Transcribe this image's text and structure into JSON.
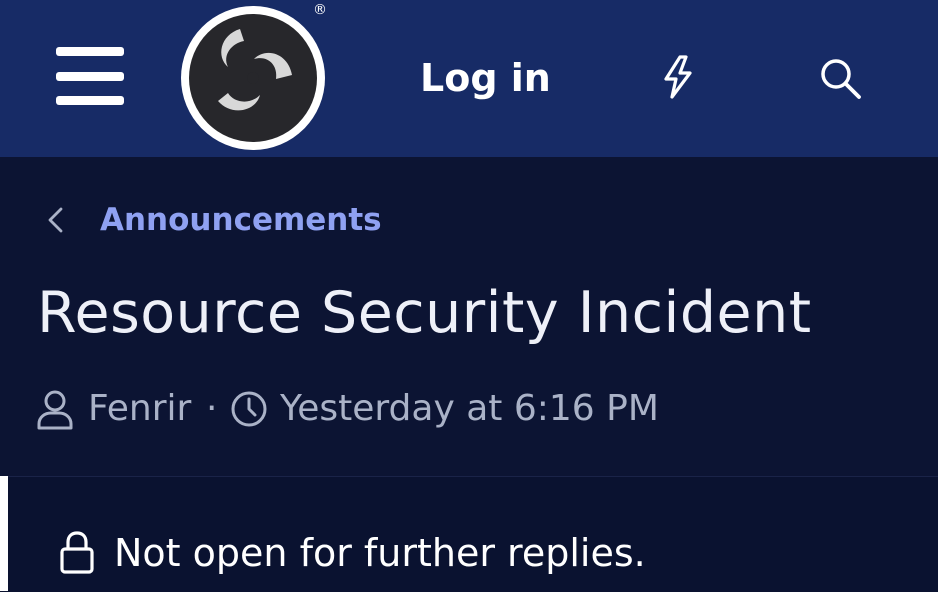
{
  "header": {
    "menu_icon": "hamburger-menu-icon",
    "logo_icon": "obs-logo",
    "registered_mark": "®",
    "login_label": "Log in",
    "whats_new_icon": "lightning-bolt-icon",
    "search_icon": "search-icon"
  },
  "breadcrumb": {
    "back_icon": "chevron-left-icon",
    "label": "Announcements"
  },
  "thread": {
    "title": "Resource Security Incident",
    "author_icon": "user-icon",
    "author": "Fenrir",
    "separator": "·",
    "time_icon": "clock-icon",
    "time": "Yesterday at 6:16 PM"
  },
  "status": {
    "lock_icon": "lock-icon",
    "text": "Not open for further replies."
  },
  "colors": {
    "header_bg": "#172b66",
    "page_bg": "#0c1433",
    "link": "#8fa1f2",
    "meta_text": "#aab2c7"
  }
}
